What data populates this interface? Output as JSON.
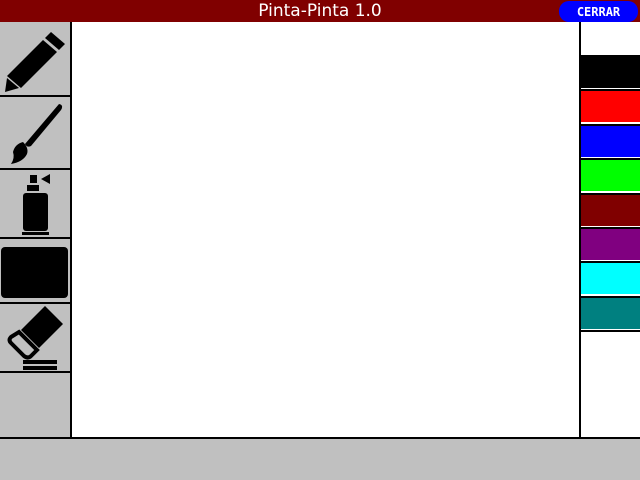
{
  "window": {
    "title": "Pinta-Pinta 1.0",
    "close_label": "CERRAR",
    "titlebar_color": "#800000",
    "close_button_color": "#0000ff"
  },
  "tools": [
    {
      "icon": "pencil-icon"
    },
    {
      "icon": "paintbrush-icon"
    },
    {
      "icon": "spray-can-icon"
    },
    {
      "icon": "filled-rectangle-icon"
    },
    {
      "icon": "eraser-icon"
    }
  ],
  "palette": {
    "colors": [
      "#000000",
      "#ff0000",
      "#0000ff",
      "#00ff00",
      "#800000",
      "#800080",
      "#00ffff",
      "#008080"
    ]
  }
}
